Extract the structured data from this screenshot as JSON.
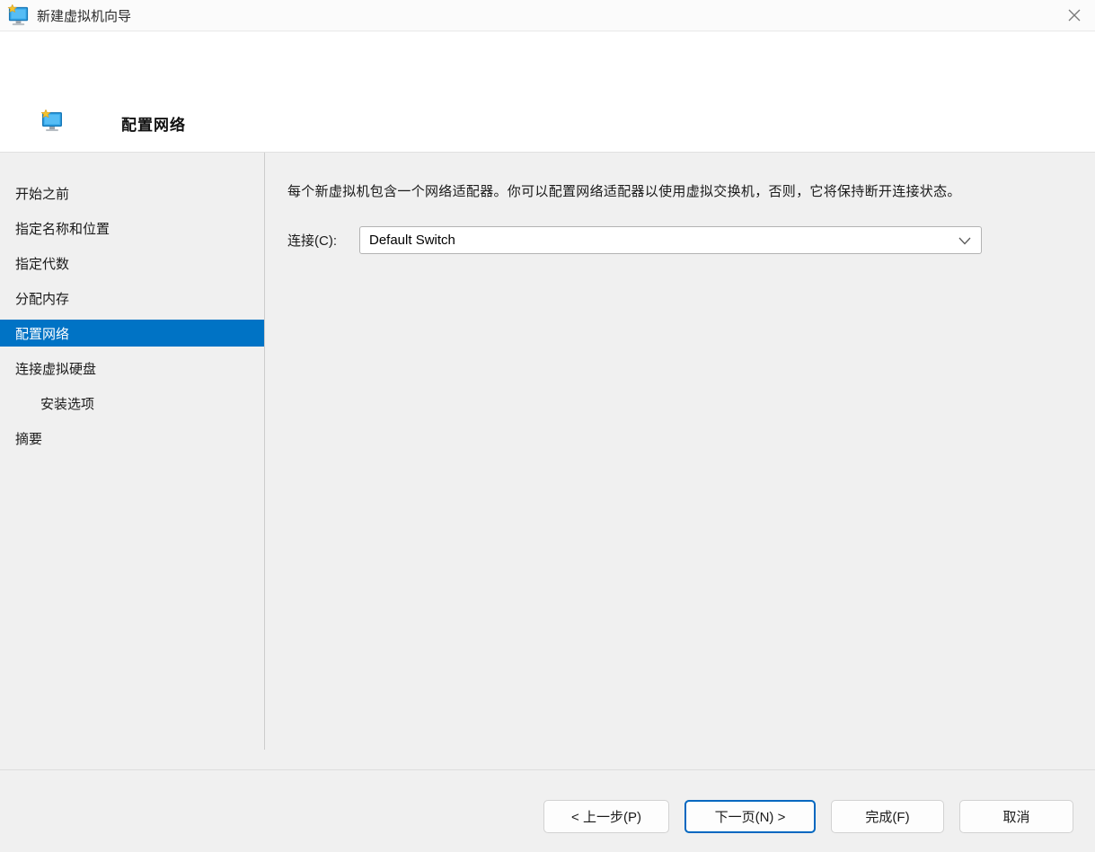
{
  "window": {
    "title": "新建虚拟机向导"
  },
  "header": {
    "title": "配置网络"
  },
  "sidebar": {
    "items": [
      {
        "label": "开始之前",
        "selected": false,
        "indent": false
      },
      {
        "label": "指定名称和位置",
        "selected": false,
        "indent": false
      },
      {
        "label": "指定代数",
        "selected": false,
        "indent": false
      },
      {
        "label": "分配内存",
        "selected": false,
        "indent": false
      },
      {
        "label": "配置网络",
        "selected": true,
        "indent": false
      },
      {
        "label": "连接虚拟硬盘",
        "selected": false,
        "indent": false
      },
      {
        "label": "安装选项",
        "selected": false,
        "indent": true
      },
      {
        "label": "摘要",
        "selected": false,
        "indent": false
      }
    ]
  },
  "main": {
    "description": "每个新虚拟机包含一个网络适配器。你可以配置网络适配器以使用虚拟交换机，否则，它将保持断开连接状态。",
    "connection_label": "连接(C):",
    "connection_value": "Default Switch"
  },
  "footer": {
    "buttons": [
      {
        "label": "< 上一步(P)",
        "default": false
      },
      {
        "label": "下一页(N) >",
        "default": true
      },
      {
        "label": "完成(F)",
        "default": false
      },
      {
        "label": "取消",
        "default": false
      }
    ]
  },
  "colors": {
    "accent": "#0073c5",
    "default_button_border": "#0067c0",
    "window_background": "#f0f0f0",
    "header_background": "#ffffff"
  },
  "icons": {
    "app_icon": "vm-monitor-with-sparkle",
    "header_icon": "vm-monitor-with-sparkle",
    "close": "x",
    "combobox_chevron": "chevron-down"
  }
}
